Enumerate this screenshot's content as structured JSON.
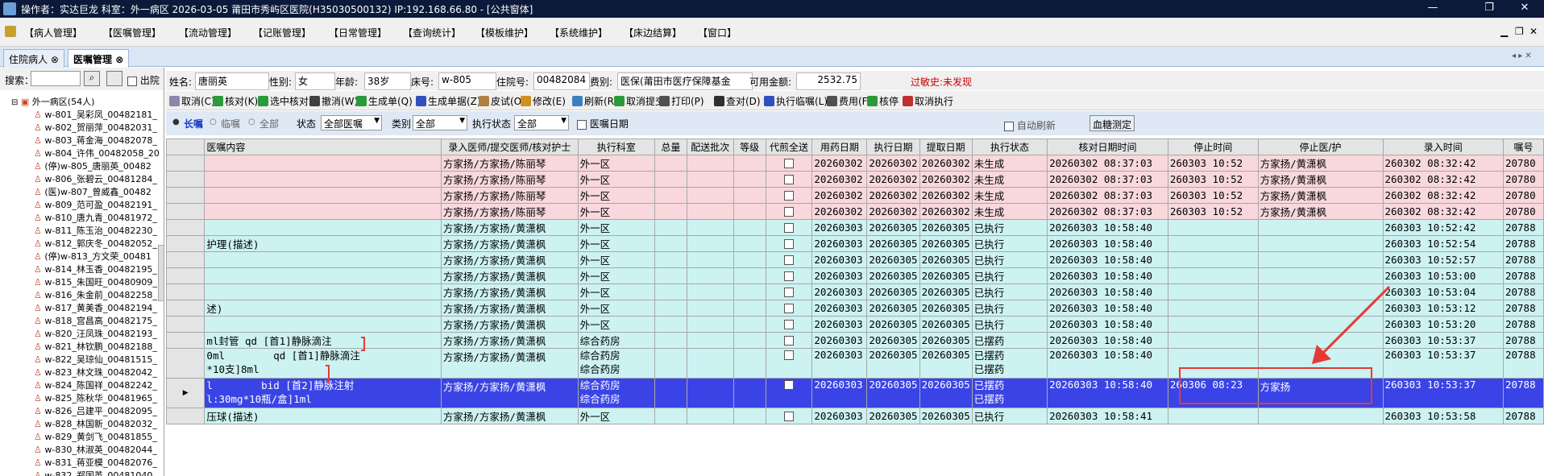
{
  "titlebar": {
    "text": "操作者：实达巨龙  科室：外一病区  2026-03-05  莆田市秀屿区医院(H35030500132) IP:192.168.66.80 - [公共窗体]",
    "minimize": "—",
    "restore": "❐",
    "close": "✕"
  },
  "menu": [
    "【病人管理】",
    "【医嘱管理】",
    "【流动管理】",
    "【记账管理】",
    "【日常管理】",
    "【查询统计】",
    "【模板维护】",
    "【系统维护】",
    "【床边结算】",
    "【窗口】"
  ],
  "tabs": [
    "住院病人",
    "医嘱管理"
  ],
  "left": {
    "search_label": "搜索：",
    "outhosp_label": "出院",
    "ward": "外一病区(54人)",
    "patients": [
      "w-801_吴彩凤_00482181_",
      "w-802_贺丽萍_00482031_",
      "w-803_蒋金海_00482078_",
      "w-804_许伟_00482058_20",
      "(停)w-805_唐丽英_00482",
      "w-806_张碧云_00481284_",
      "(医)w-807_曾威鑫_00482",
      "w-809_范可盈_00482191_",
      "w-810_唐九青_00481972_",
      "w-811_陈玉治_00482230_",
      "w-812_郭庆冬_00482052_",
      "(停)w-813_方文荣_00481",
      "w-814_林玉香_00482195_",
      "w-815_朱国旺_00480909_",
      "w-816_朱金前_00482258_",
      "w-817_黄美香_00482194_",
      "w-818_宫昌高_00482175_",
      "w-820_汪凤珠_00482193_",
      "w-821_林钦鹏_00482188_",
      "w-822_吴琼仙_00481515_",
      "w-823_林文珠_00482042_",
      "w-824_陈国祥_00482242_",
      "w-825_陈秋华_00481965_",
      "w-826_吕建平_00482095_",
      "w-828_林国新_00482032_",
      "w-829_黄剑飞_00481855_",
      "w-830_林淑英_00482044_",
      "w-831_蒋亚模_00482076_",
      "w-832_郑国英_00481040"
    ]
  },
  "patient": {
    "name_label": "姓名:",
    "name": "唐丽英",
    "sex_label": "性别:",
    "sex": "女",
    "age_label": "年龄:",
    "age": "38岁",
    "bed_label": "床号:",
    "bed": "w-805",
    "inpatient_label": "住院号:",
    "inpatient_no": "00482084",
    "fee_label": "费别:",
    "fee": "医保(莆田市医疗保障基金",
    "balance_label": "可用金额:",
    "balance": "2532.75",
    "allergy": "过敏史:未发现"
  },
  "toolbar": [
    "取消(C)",
    "核对(K)",
    "选中核对",
    "撤消(W)",
    "生成单(Q)",
    "生成单据(Z)",
    "皮试(O)",
    "修改(E)",
    "刷新(R)",
    "取消提交",
    "打印(P)",
    "查对(D)",
    "执行临嘱(L)",
    "费用(F)",
    "核停",
    "取消执行"
  ],
  "filter": {
    "long": "长嘱",
    "temp": "临嘱",
    "all": "全部",
    "status_label": "状态",
    "status_value": "全部医嘱",
    "category_label": "类别",
    "category_value": "全部",
    "exec_label": "执行状态",
    "exec_value": "全部",
    "date_label": "医嘱日期",
    "auto_refresh": "自动刷新",
    "blood_btn": "血糖测定"
  },
  "grid": {
    "headers": [
      "医嘱内容",
      "录入医师/提交医师/核对护士",
      "执行科室",
      "总量",
      "配送批次",
      "等级",
      "代煎全送",
      "用药日期",
      "执行日期",
      "提取日期",
      "执行状态",
      "核对日期时间",
      "停止时间",
      "停止医/护",
      "录入时间",
      "嘱号"
    ],
    "rows": [
      {
        "style": "pink",
        "content": "",
        "doctor": "方家扬/方家扬/陈丽琴",
        "dept": "外一区",
        "use": "20260302",
        "exec": "20260302",
        "extract": "20260302",
        "status": "未生成",
        "check": "20260302 08:37:03",
        "stop": "260303 10:52",
        "stopby": "方家扬/黄潇枫",
        "entry": "260302 08:32:42",
        "no": "20780"
      },
      {
        "style": "pink",
        "content": "",
        "doctor": "方家扬/方家扬/陈丽琴",
        "dept": "外一区",
        "use": "20260302",
        "exec": "20260302",
        "extract": "20260302",
        "status": "未生成",
        "check": "20260302 08:37:03",
        "stop": "260303 10:52",
        "stopby": "方家扬/黄潇枫",
        "entry": "260302 08:32:42",
        "no": "20780"
      },
      {
        "style": "pink",
        "content": "",
        "doctor": "方家扬/方家扬/陈丽琴",
        "dept": "外一区",
        "use": "20260302",
        "exec": "20260302",
        "extract": "20260302",
        "status": "未生成",
        "check": "20260302 08:37:03",
        "stop": "260303 10:52",
        "stopby": "方家扬/黄潇枫",
        "entry": "260302 08:32:42",
        "no": "20780"
      },
      {
        "style": "pink",
        "content": "",
        "doctor": "方家扬/方家扬/陈丽琴",
        "dept": "外一区",
        "use": "20260302",
        "exec": "20260302",
        "extract": "20260302",
        "status": "未生成",
        "check": "20260302 08:37:03",
        "stop": "260303 10:52",
        "stopby": "方家扬/黄潇枫",
        "entry": "260302 08:32:42",
        "no": "20780"
      },
      {
        "style": "cyan",
        "content": "",
        "doctor": "方家扬/方家扬/黄潇枫",
        "dept": "外一区",
        "use": "20260303",
        "exec": "20260305",
        "extract": "20260305",
        "status": "已执行",
        "check": "20260303 10:58:40",
        "stop": "",
        "stopby": "",
        "entry": "260303 10:52:42",
        "no": "20788"
      },
      {
        "style": "cyan",
        "content": "护理(描述)",
        "doctor": "方家扬/方家扬/黄潇枫",
        "dept": "外一区",
        "use": "20260303",
        "exec": "20260305",
        "extract": "20260305",
        "status": "已执行",
        "check": "20260303 10:58:40",
        "stop": "",
        "stopby": "",
        "entry": "260303 10:52:54",
        "no": "20788"
      },
      {
        "style": "cyan",
        "content": "",
        "doctor": "方家扬/方家扬/黄潇枫",
        "dept": "外一区",
        "use": "20260303",
        "exec": "20260305",
        "extract": "20260305",
        "status": "已执行",
        "check": "20260303 10:58:40",
        "stop": "",
        "stopby": "",
        "entry": "260303 10:52:57",
        "no": "20788"
      },
      {
        "style": "cyan",
        "content": "",
        "doctor": "方家扬/方家扬/黄潇枫",
        "dept": "外一区",
        "use": "20260303",
        "exec": "20260305",
        "extract": "20260305",
        "status": "已执行",
        "check": "20260303 10:58:40",
        "stop": "",
        "stopby": "",
        "entry": "260303 10:53:00",
        "no": "20788"
      },
      {
        "style": "cyan",
        "content": "",
        "doctor": "方家扬/方家扬/黄潇枫",
        "dept": "外一区",
        "use": "20260303",
        "exec": "20260305",
        "extract": "20260305",
        "status": "已执行",
        "check": "20260303 10:58:40",
        "stop": "",
        "stopby": "",
        "entry": "260303 10:53:04",
        "no": "20788"
      },
      {
        "style": "cyan",
        "content": "述)",
        "doctor": "方家扬/方家扬/黄潇枫",
        "dept": "外一区",
        "use": "20260303",
        "exec": "20260305",
        "extract": "20260305",
        "status": "已执行",
        "check": "20260303 10:58:40",
        "stop": "",
        "stopby": "",
        "entry": "260303 10:53:12",
        "no": "20788"
      },
      {
        "style": "cyan",
        "content": "",
        "doctor": "方家扬/方家扬/黄潇枫",
        "dept": "外一区",
        "use": "20260303",
        "exec": "20260305",
        "extract": "20260305",
        "status": "已执行",
        "check": "20260303 10:58:40",
        "stop": "",
        "stopby": "",
        "entry": "260303 10:53:20",
        "no": "20788"
      },
      {
        "style": "cyan",
        "content": "ml封管  qd [首1]静脉滴注",
        "doctor": "方家扬/方家扬/黄潇枫",
        "dept": "综合药房",
        "use": "20260303",
        "exec": "20260305",
        "extract": "20260305",
        "status": "已摆药",
        "check": "20260303 10:58:40",
        "stop": "",
        "stopby": "",
        "entry": "260303 10:53:37",
        "no": "20788"
      },
      {
        "style": "cyan2",
        "content": "0ml",
        "content_b": "qd [首1]静脉滴注",
        "content2": "*10支]8ml",
        "doctor": "方家扬/方家扬/黄潇枫",
        "dept": "综合药房",
        "dept2": "综合药房",
        "use": "20260303",
        "exec": "20260305",
        "extract": "20260305",
        "status": "已摆药",
        "status2": "已摆药",
        "check": "20260303 10:58:40",
        "stop": "",
        "stopby": "",
        "entry": "260303 10:53:37",
        "no": "20788"
      },
      {
        "style": "sel",
        "content": "l",
        "content_b": "bid [首2]静脉注射",
        "content2": "l:30mg*10瓶/盒]1ml",
        "doctor": "方家扬/方家扬/黄潇枫",
        "dept": "综合药房",
        "dept2": "综合药房",
        "use": "20260303",
        "exec": "20260305",
        "extract": "20260305",
        "status": "已摆药",
        "status2": "已摆药",
        "check": "20260303 10:58:40",
        "stop": "260306 08:23",
        "stopby": "方家扬",
        "entry": "260303 10:53:37",
        "no": "20788"
      },
      {
        "style": "cyan",
        "content": "压球(描述)",
        "doctor": "方家扬/方家扬/黄潇枫",
        "dept": "外一区",
        "use": "20260303",
        "exec": "20260305",
        "extract": "20260305",
        "status": "已执行",
        "check": "20260303 10:58:41",
        "stop": "",
        "stopby": "",
        "entry": "260303 10:53:58",
        "no": "20788"
      }
    ]
  },
  "colors": {
    "selected": "#3a44e6",
    "pink": "#f8d8dc",
    "cyan": "#cdf2f2",
    "annotation": "#e53935"
  }
}
